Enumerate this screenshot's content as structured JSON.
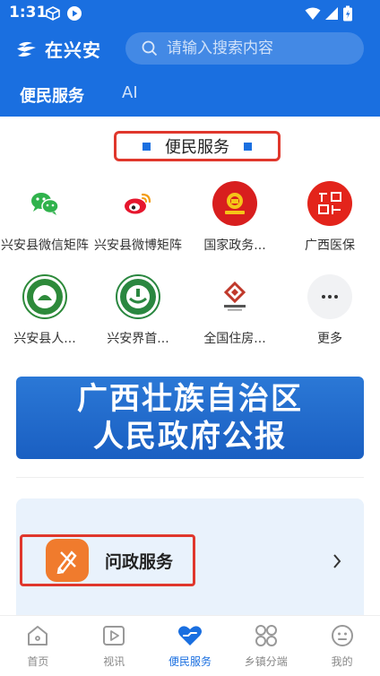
{
  "status_bar": {
    "time": "1:31"
  },
  "header": {
    "brand": "在兴安",
    "search_placeholder": "请输入搜索内容",
    "tabs": [
      {
        "label": "便民服务",
        "active": true
      },
      {
        "label": "AI",
        "active": false
      }
    ]
  },
  "section": {
    "title": "便民服务"
  },
  "services": [
    {
      "label": "兴安县微信矩阵",
      "icon": "wechat-icon"
    },
    {
      "label": "兴安县微博矩阵",
      "icon": "weibo-icon"
    },
    {
      "label": "国家政务...",
      "icon": "national-emblem-icon"
    },
    {
      "label": "广西医保",
      "icon": "guangxi-medical-insurance-icon"
    },
    {
      "label": "兴安县人...",
      "icon": "xingan-county-seal-icon"
    },
    {
      "label": "兴安界首...",
      "icon": "jieshou-seal-icon"
    },
    {
      "label": "全国住房...",
      "icon": "housing-fund-icon"
    },
    {
      "label": "更多",
      "icon": "more-icon"
    }
  ],
  "banner": {
    "line1": "广西壮族自治区",
    "line2": "人民政府公报"
  },
  "card": {
    "label": "问政服务"
  },
  "bottom_nav": [
    {
      "label": "首页",
      "icon": "home-icon",
      "active": false
    },
    {
      "label": "视讯",
      "icon": "video-icon",
      "active": false
    },
    {
      "label": "便民服务",
      "icon": "heart-hand-icon",
      "active": true
    },
    {
      "label": "乡镇分端",
      "icon": "grid-icon",
      "active": false
    },
    {
      "label": "我的",
      "icon": "profile-icon",
      "active": false
    }
  ],
  "colors": {
    "primary": "#1a6fe0",
    "highlight_border": "#e0372c",
    "card_bg": "#e9f2fc",
    "orange": "#f07b2d"
  }
}
